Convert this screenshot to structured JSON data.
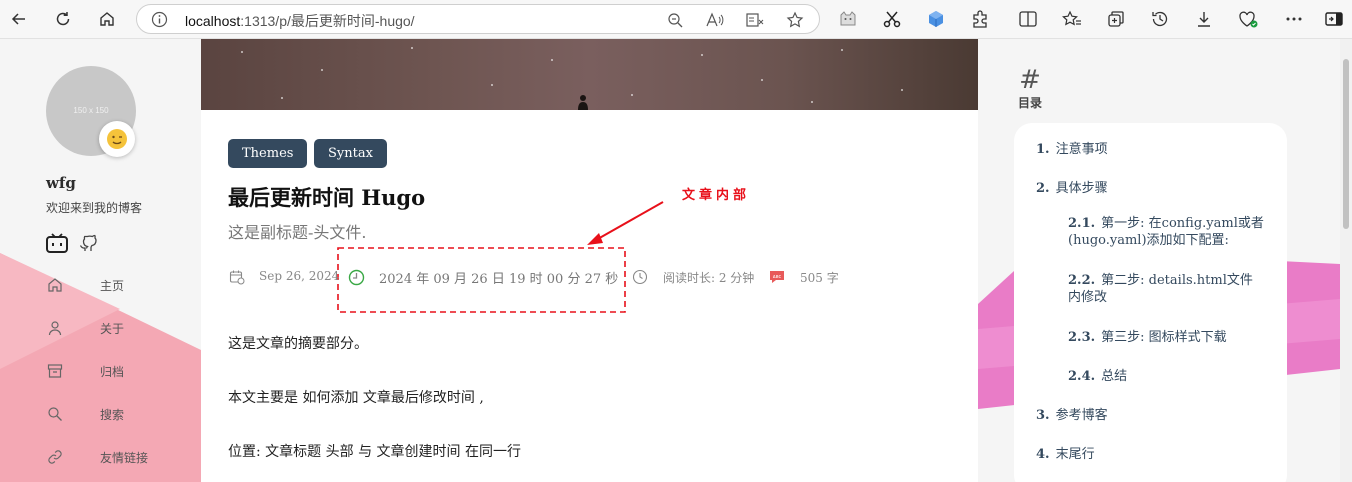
{
  "browser": {
    "url_host": "localhost",
    "url_path": ":1313/p/最后更新时间-hugo/"
  },
  "sidebar": {
    "avatar_placeholder": "150 x 150",
    "site_name": "wfg",
    "site_desc": "欢迎来到我的博客",
    "menu": [
      {
        "label": "主页"
      },
      {
        "label": "关于"
      },
      {
        "label": "归档"
      },
      {
        "label": "搜索"
      },
      {
        "label": "友情链接"
      }
    ]
  },
  "article": {
    "tags": [
      "Themes",
      "Syntax"
    ],
    "title": "最后更新时间 Hugo",
    "subtitle": "这是副标题-头文件.",
    "date": "Sep 26, 2024",
    "modified": "2024 年 09 月 26 日 19 时 00 分 27 秒",
    "reading_time": "阅读时长: 2 分钟",
    "word_count": "505 字",
    "annotation": "文章内部",
    "paragraphs": [
      "这是文章的摘要部分。",
      "本文主要是 如何添加 文章最后修改时间 ,",
      "位置: 文章标题 头部 与 文章创建时间 在同一行"
    ]
  },
  "toc": {
    "hash": "#",
    "label": "目录",
    "items": [
      {
        "num": "1.",
        "text": "注意事项"
      },
      {
        "num": "2.",
        "text": "具体步骤"
      },
      {
        "num": "2.1.",
        "text": "第一步: 在config.yaml或者",
        "text2": "(hugo.yaml)添加如下配置:"
      },
      {
        "num": "2.2.",
        "text": "第二步: details.html文件",
        "text2": "内修改"
      },
      {
        "num": "2.3.",
        "text": "第三步: 图标样式下载"
      },
      {
        "num": "2.4.",
        "text": "总结"
      },
      {
        "num": "3.",
        "text": "参考博客"
      },
      {
        "num": "4.",
        "text": "末尾行"
      }
    ]
  }
}
